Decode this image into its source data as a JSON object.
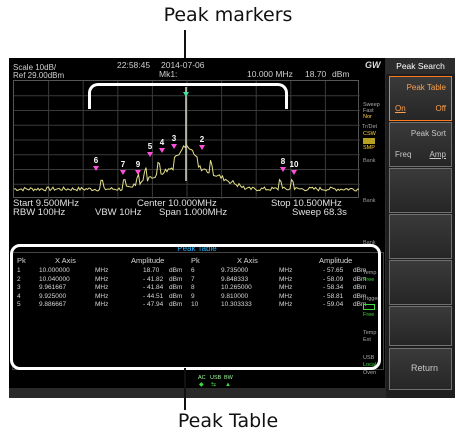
{
  "callouts": {
    "top": "Peak markers",
    "bottom": "Peak Table"
  },
  "header": {
    "scale": "Scale 10dB/",
    "ref": "Ref 29.00dBm",
    "time": "22:58:45",
    "date": "2014-07-06",
    "marker": "Mk1:",
    "marker_freq": "10.000 MHz",
    "marker_amp": "18.70",
    "marker_unit": "dBm",
    "logo": "GW"
  },
  "plot_footer": {
    "start": "Start 9.500MHz",
    "center": "Center 10.000MHz",
    "stop": "Stop 10.500MHz",
    "rbw": "RBW 100Hz",
    "vbw": "VBW 10Hz",
    "span": "Span 1.000MHz",
    "sweep": "Sweep 68.3s"
  },
  "peak_markers": [
    "1",
    "2",
    "3",
    "4",
    "5",
    "6",
    "7",
    "8",
    "9",
    "10"
  ],
  "peak_table": {
    "title": "Peak Table",
    "headers": {
      "pk": "Pk",
      "x_axis": "X Axis",
      "amplitude": "Amplitude"
    },
    "rows_left": [
      {
        "pk": "1",
        "freq": "10.000000",
        "funit": "MHz",
        "amp": "18.70",
        "aunit": "dBm"
      },
      {
        "pk": "2",
        "freq": "10.040000",
        "funit": "MHz",
        "amp": "- 41.82",
        "aunit": "dBm"
      },
      {
        "pk": "3",
        "freq": "9.961667",
        "funit": "MHz",
        "amp": "- 41.84",
        "aunit": "dBm"
      },
      {
        "pk": "4",
        "freq": "9.925000",
        "funit": "MHz",
        "amp": "- 44.51",
        "aunit": "dBm"
      },
      {
        "pk": "5",
        "freq": "9.886667",
        "funit": "MHz",
        "amp": "- 47.94",
        "aunit": "dBm"
      }
    ],
    "rows_right": [
      {
        "pk": "6",
        "freq": "9.735000",
        "funit": "MHz",
        "amp": "- 57.65",
        "aunit": "dBm"
      },
      {
        "pk": "7",
        "freq": "9.848333",
        "funit": "MHz",
        "amp": "- 58.09",
        "aunit": "dBm"
      },
      {
        "pk": "8",
        "freq": "10.265000",
        "funit": "MHz",
        "amp": "- 58.34",
        "aunit": "dBm"
      },
      {
        "pk": "9",
        "freq": "9.810000",
        "funit": "MHz",
        "amp": "- 58.81",
        "aunit": "dBm"
      },
      {
        "pk": "10",
        "freq": "10.303333",
        "funit": "MHz",
        "amp": "- 59.04",
        "aunit": "dBm"
      }
    ]
  },
  "status_column": {
    "sweep": "Sweep",
    "fast": "Fast",
    "nor": "Nor",
    "trdet": "Tr/Det",
    "csw": "CSW",
    "smp": "SMP",
    "bank": "Bank",
    "temp": "Temp",
    "trigger": "Trigger",
    "free": "Free",
    "ext": "Ext",
    "usb": "USB",
    "local": "Local",
    "oven": "Oven"
  },
  "bottom_status": {
    "ac": "AC",
    "usb": "USB",
    "bw": "BW"
  },
  "menu": {
    "title": "Peak Search",
    "peak_table": {
      "label": "Peak Table",
      "opt_on": "On",
      "opt_off": "Off"
    },
    "peak_sort": {
      "label": "Peak Sort",
      "opt_freq": "Freq",
      "opt_amp": "Amp"
    },
    "return": "Return"
  },
  "colors": {
    "trace": "#e4e08a",
    "marker": "#ff4fd8",
    "active_marker": "#44e0a0",
    "accent": "#ff7a1a",
    "table_title": "#27b7ff"
  }
}
